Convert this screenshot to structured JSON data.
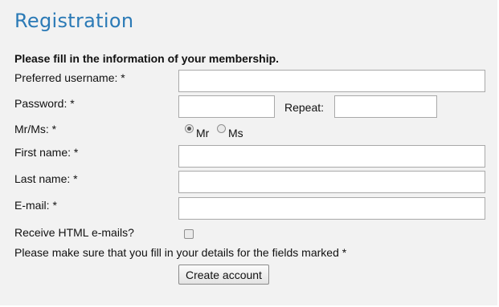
{
  "form": {
    "title": "Registration",
    "intro": "Please fill in the information of your membership.",
    "username_label": "Preferred username: *",
    "username_value": "",
    "password_label": "Password: *",
    "password_value": "",
    "repeat_label": "Repeat:",
    "repeat_value": "",
    "salutation_label": "Mr/Ms: *",
    "salutation_options": [
      "Mr",
      "Ms"
    ],
    "salutation_selected": "Mr",
    "first_name_label": "First name: *",
    "first_name_value": "",
    "last_name_label": "Last name: *",
    "last_name_value": "",
    "email_label": "E-mail: *",
    "email_value": "",
    "html_emails_label": "Receive HTML e-mails?",
    "html_emails_checked": false,
    "notice": "Please make sure that you fill in your details for the fields marked *",
    "submit_label": "Create account"
  }
}
